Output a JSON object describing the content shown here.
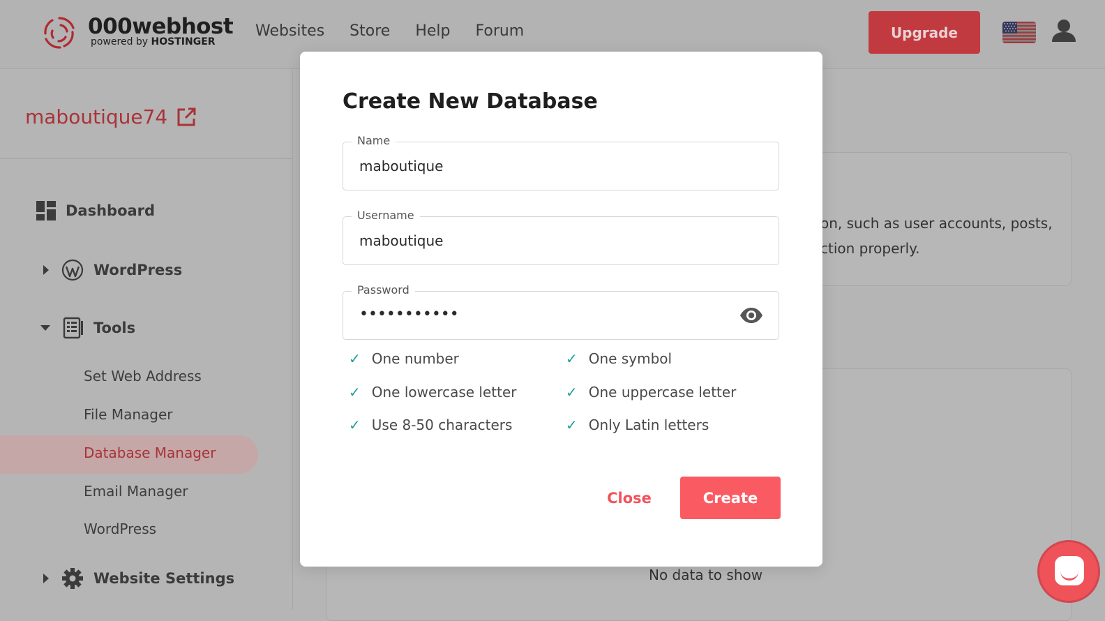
{
  "header": {
    "logo_main": "000webhost",
    "logo_sub_prefix": "powered by ",
    "logo_sub_brand": "HOSTINGER",
    "nav": [
      "Websites",
      "Store",
      "Help",
      "Forum"
    ],
    "upgrade_label": "Upgrade"
  },
  "sidebar": {
    "site_name": "maboutique74",
    "items": {
      "dashboard": "Dashboard",
      "wordpress": "WordPress",
      "tools": "Tools",
      "website_settings": "Website Settings"
    },
    "tools_sub": [
      "Set Web Address",
      "File Manager",
      "Database Manager",
      "Email Manager",
      "WordPress"
    ],
    "active_sub": "Database Manager"
  },
  "background": {
    "card_text_line1": "on, such as user accounts, posts,",
    "card_text_line2": "ction properly.",
    "no_data": "No data to show"
  },
  "modal": {
    "title": "Create New Database",
    "name_label": "Name",
    "name_value": "maboutique",
    "username_label": "Username",
    "username_value": "maboutique",
    "password_label": "Password",
    "password_value": "•••••••••••",
    "requirements": [
      "One number",
      "One symbol",
      "One lowercase letter",
      "One uppercase letter",
      "Use 8-50 characters",
      "Only Latin letters"
    ],
    "close_label": "Close",
    "create_label": "Create"
  },
  "colors": {
    "accent": "#fa5b63",
    "check": "#1a9c9a",
    "upgrade": "#c13a3f"
  }
}
